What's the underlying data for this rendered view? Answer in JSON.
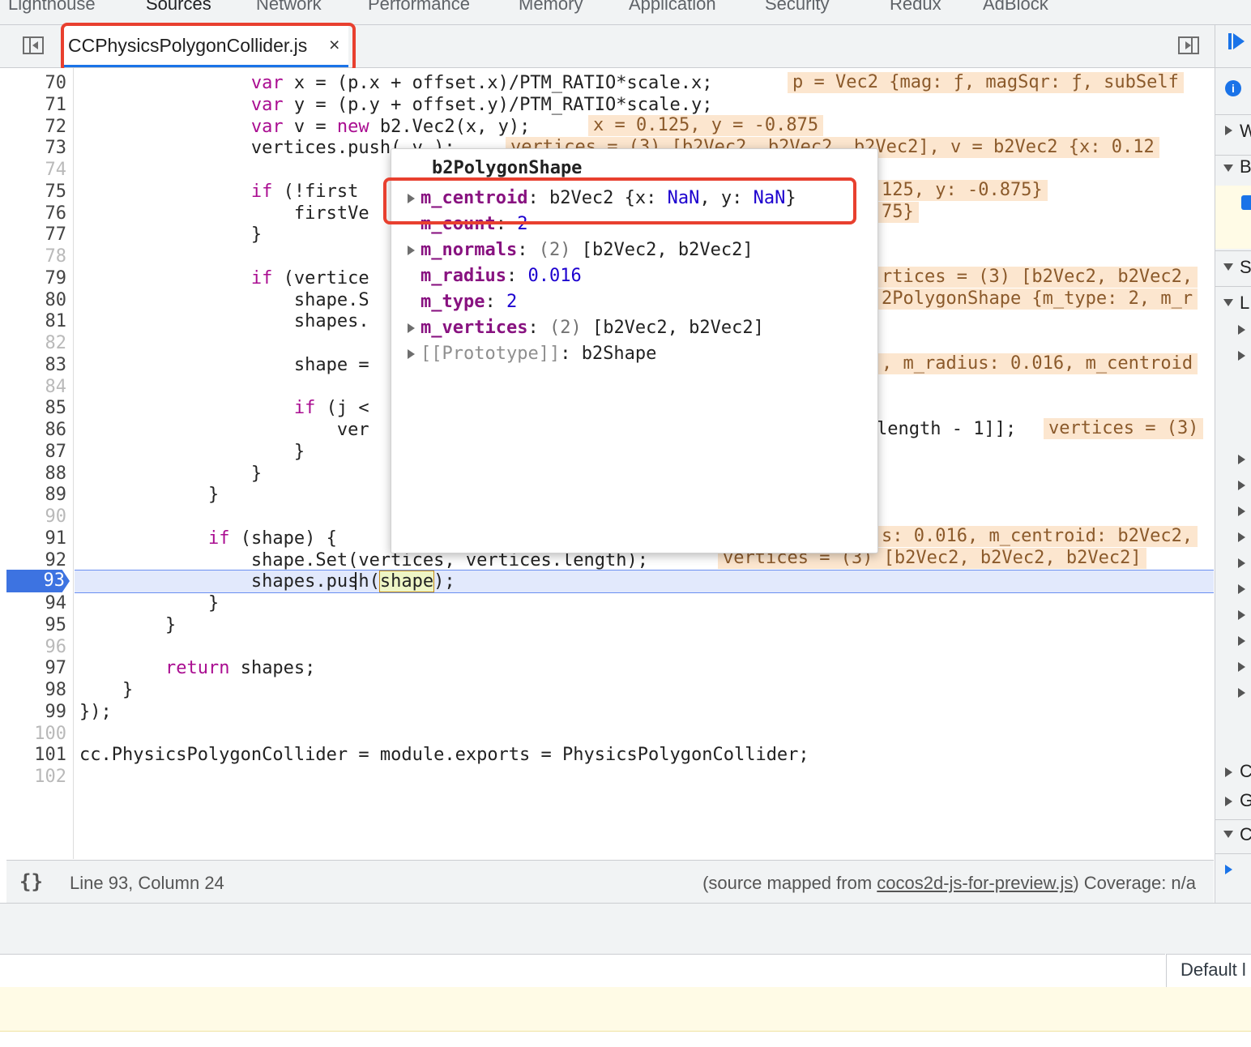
{
  "top_tabs": [
    "Lighthouse",
    "Sources",
    "Network",
    "Performance",
    "Memory",
    "Application",
    "Security",
    "Redux",
    "AdBlock"
  ],
  "file_tab": {
    "name": "CCPhysicsPolygonCollider.js",
    "close": "×"
  },
  "editor": {
    "current_line": "93",
    "lines": [
      {
        "n": "70",
        "text": "                var x = (p.x + offset.x)/PTM_RATIO*scale.x;"
      },
      {
        "n": "71",
        "text": "                var y = (p.y + offset.y)/PTM_RATIO*scale.y;"
      },
      {
        "n": "72",
        "text": "                var v = new b2.Vec2(x, y);"
      },
      {
        "n": "73",
        "text": "                vertices.push( v );"
      },
      {
        "n": "74",
        "text": ""
      },
      {
        "n": "75",
        "text": "                if (!first"
      },
      {
        "n": "76",
        "text": "                    firstVe"
      },
      {
        "n": "77",
        "text": "                }"
      },
      {
        "n": "78",
        "text": ""
      },
      {
        "n": "79",
        "text": "                if (vertice"
      },
      {
        "n": "80",
        "text": "                    shape.S"
      },
      {
        "n": "81",
        "text": "                    shapes."
      },
      {
        "n": "82",
        "text": ""
      },
      {
        "n": "83",
        "text": "                    shape ="
      },
      {
        "n": "84",
        "text": ""
      },
      {
        "n": "85",
        "text": "                    if (j <"
      },
      {
        "n": "86",
        "text": "                        ver"
      },
      {
        "n": "87",
        "text": "                    }"
      },
      {
        "n": "88",
        "text": "                }"
      },
      {
        "n": "89",
        "text": "            }"
      },
      {
        "n": "90",
        "text": ""
      },
      {
        "n": "91",
        "text": "            if (shape) {"
      },
      {
        "n": "92",
        "text": "                shape.Set(vertices, vertices.length);"
      },
      {
        "n": "93",
        "text": "                shapes.push(shape);"
      },
      {
        "n": "94",
        "text": "            }"
      },
      {
        "n": "95",
        "text": "        }"
      },
      {
        "n": "96",
        "text": ""
      },
      {
        "n": "97",
        "text": "        return shapes;"
      },
      {
        "n": "98",
        "text": "    }"
      },
      {
        "n": "99",
        "text": "});"
      },
      {
        "n": "100",
        "text": ""
      },
      {
        "n": "101",
        "text": "cc.PhysicsPolygonCollider = module.exports = PhysicsPolygonCollider;"
      },
      {
        "n": "102",
        "text": ""
      }
    ],
    "inline_values": {
      "l70": "p = Vec2 {mag: ƒ, magSqr: ƒ, subSelf",
      "l72": "x = 0.125, y = -0.875",
      "l73": "vertices = (3) [b2Vec2, b2Vec2, b2Vec2], v = b2Vec2 {x: 0.12",
      "l75": "125, y: -0.875}",
      "l76": "75}",
      "l79": "rtices = (3) [b2Vec2, b2Vec2,",
      "l80": "2PolygonShape {m_type: 2, m_r",
      "l83": ", m_radius: 0.016, m_centroid",
      "l86_code": "length - 1]];",
      "l86": "vertices = (3)",
      "l91": "s: 0.016, m_centroid: b2Vec2,",
      "l92": "vertices = (3) [b2Vec2, b2Vec2, b2Vec2]"
    }
  },
  "popover": {
    "title": "b2PolygonShape",
    "props": [
      {
        "key": "m_centroid",
        "value": "b2Vec2 {x: NaN, y: NaN}",
        "expandable": true
      },
      {
        "key": "m_count",
        "value": "2",
        "expandable": false
      },
      {
        "key": "m_normals",
        "value": "(2) [b2Vec2, b2Vec2]",
        "expandable": true
      },
      {
        "key": "m_radius",
        "value": "0.016",
        "expandable": false
      },
      {
        "key": "m_type",
        "value": "2",
        "expandable": false
      },
      {
        "key": "m_vertices",
        "value": "(2) [b2Vec2, b2Vec2]",
        "expandable": true
      },
      {
        "key": "[[Prototype]]",
        "value": "b2Shape",
        "expandable": true
      }
    ]
  },
  "status_bar": {
    "format_button": "{}",
    "position": "Line 93, Column 24",
    "source_prefix": "(source mapped from ",
    "source_file": "cocos2d-js-for-preview.js",
    "source_suffix": ")",
    "coverage": "Coverage: n/a"
  },
  "right_pane": {
    "letters": [
      "W",
      "B",
      "S",
      "L",
      "C",
      "G",
      "C"
    ]
  },
  "console": {
    "default_levels": "Default l"
  },
  "colors": {
    "accent": "#1a73e8",
    "highlight_box": "#e8402f",
    "keyword": "#aa0d91",
    "number": "#1c00cf",
    "inline_value_bg": "#fce6cf",
    "execution_line": "#e2e9fc"
  }
}
